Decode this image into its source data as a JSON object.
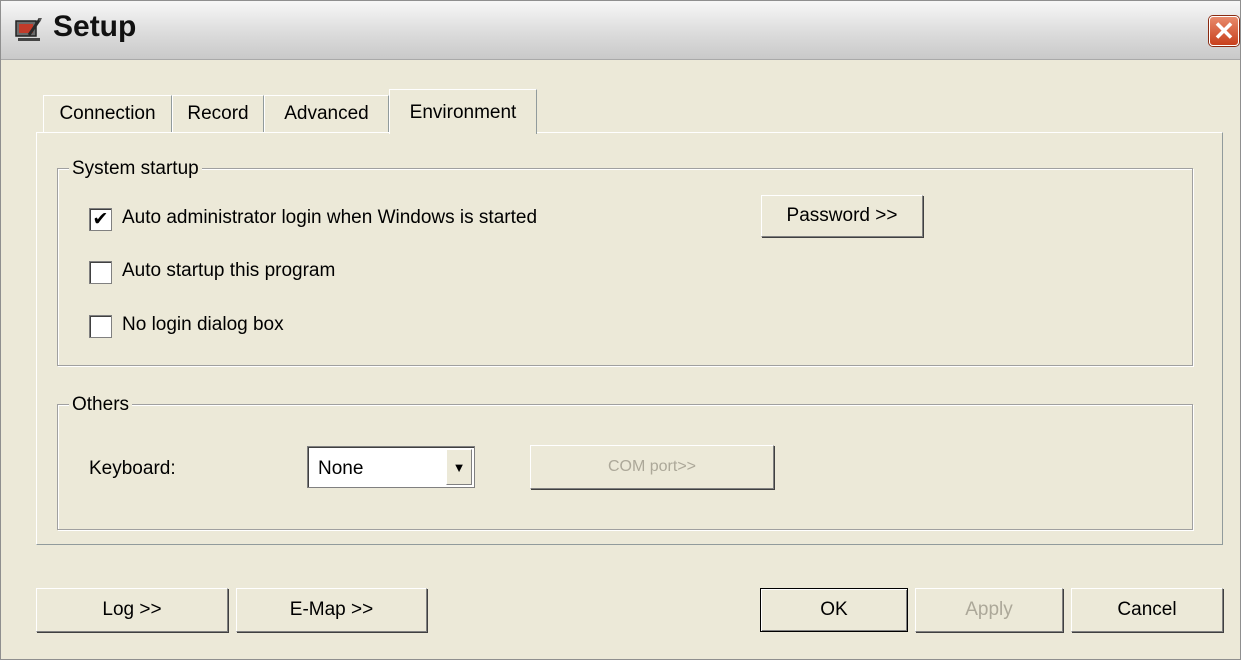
{
  "window": {
    "title": "Setup",
    "close_glyph": "✕",
    "icon": "setup-app-icon"
  },
  "tabs": [
    {
      "label": "Connection",
      "active": false
    },
    {
      "label": "Record",
      "active": false
    },
    {
      "label": "Advanced",
      "active": false
    },
    {
      "label": "Environment",
      "active": true
    }
  ],
  "system_startup": {
    "legend": "System startup",
    "options": [
      {
        "label": "Auto administrator login when Windows is started",
        "checked": true,
        "check_mark": "✔"
      },
      {
        "label": "Auto startup this program",
        "checked": false,
        "check_mark": ""
      },
      {
        "label": "No login dialog box",
        "checked": false,
        "check_mark": ""
      }
    ],
    "password_button": "Password >>"
  },
  "others": {
    "legend": "Others",
    "keyboard_label": "Keyboard:",
    "keyboard_value": "None",
    "dropdown_arrow": "▼",
    "com_port_button": "COM port>>",
    "com_port_enabled": false
  },
  "footer": {
    "log_button": "Log >>",
    "emap_button": "E-Map >>",
    "ok_button": "OK",
    "apply_button": "Apply",
    "apply_enabled": false,
    "cancel_button": "Cancel"
  },
  "colors": {
    "face": "#ece9d8",
    "disabled_text": "#aca899",
    "close_red": "#c8401d"
  }
}
